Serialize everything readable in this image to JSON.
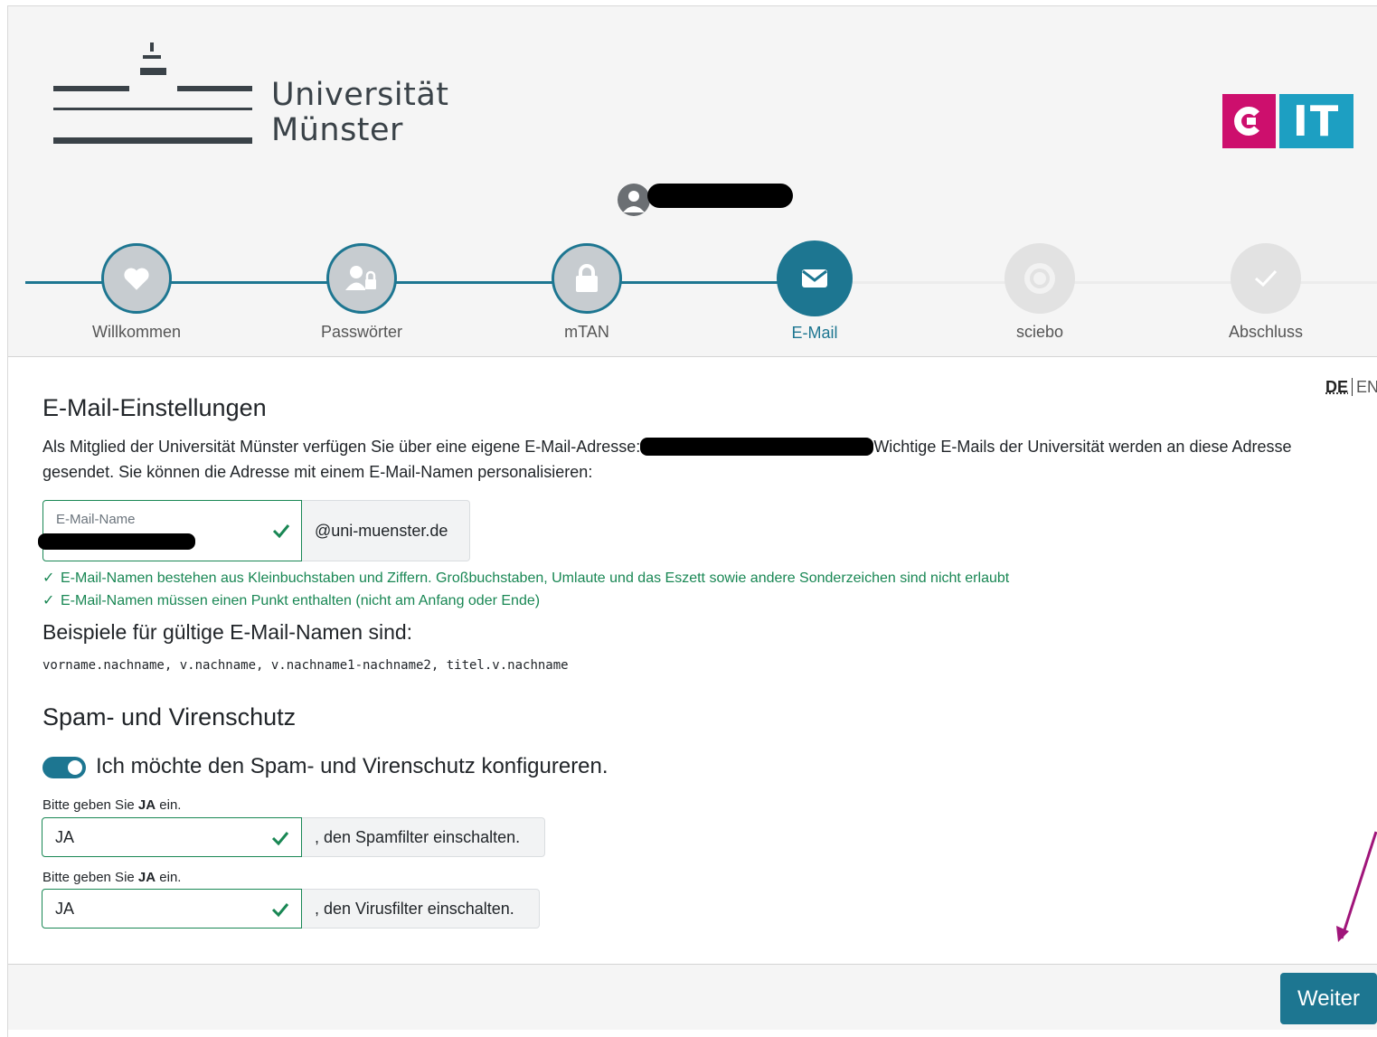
{
  "header": {
    "logo_line1": "Universität",
    "logo_line2": "Münster",
    "cit_logo_text": "IT",
    "colors": {
      "brand_teal": "#1d7691",
      "cit_magenta": "#cd0f6d",
      "cit_blue": "#1d9fc2"
    }
  },
  "steps": [
    {
      "label": "Willkommen",
      "icon": "heart-icon",
      "state": "done"
    },
    {
      "label": "Passwörter",
      "icon": "user-lock-icon",
      "state": "done"
    },
    {
      "label": "mTAN",
      "icon": "lock-icon",
      "state": "done"
    },
    {
      "label": "E-Mail",
      "icon": "envelope-icon",
      "state": "active"
    },
    {
      "label": "sciebo",
      "icon": "sciebo-icon",
      "state": "todo"
    },
    {
      "label": "Abschluss",
      "icon": "checkmark-icon",
      "state": "todo"
    }
  ],
  "lang": {
    "de": "DE",
    "en": "EN"
  },
  "email_section": {
    "title": "E-Mail-Einstellungen",
    "intro_before": "Als Mitglied der Universität Münster verfügen Sie über eine eigene E-Mail-Adresse:",
    "intro_after": "Wichtige E-Mails der Universität werden an diese Adresse gesendet. Sie können die Adresse mit einem E-Mail-Namen personalisieren:",
    "field_label": "E-Mail-Name",
    "domain_suffix": "@uni-muenster.de",
    "hints": [
      "E-Mail-Namen bestehen aus Kleinbuchstaben und Ziffern. Großbuchstaben, Umlaute und das Eszett sowie andere Sonderzeichen sind nicht erlaubt",
      "E-Mail-Namen müssen einen Punkt enthalten (nicht am Anfang oder Ende)"
    ],
    "examples_title": "Beispiele für gültige E-Mail-Namen sind:",
    "examples": "vorname.nachname, v.nachname, v.nachname1-nachname2, titel.v.nachname"
  },
  "spam_section": {
    "title": "Spam- und Virenschutz",
    "toggle_label": "Ich möchte den Spam- und Virenschutz konfigureren.",
    "toggle_on": true,
    "prompt_before": "Bitte geben Sie ",
    "prompt_bold": "JA",
    "prompt_after": " ein.",
    "spam_value": "JA",
    "spam_suffix": ", den Spamfilter einschalten.",
    "virus_value": "JA",
    "virus_suffix": ", den Virusfilter einschalten."
  },
  "footer": {
    "next_label": "Weiter"
  }
}
